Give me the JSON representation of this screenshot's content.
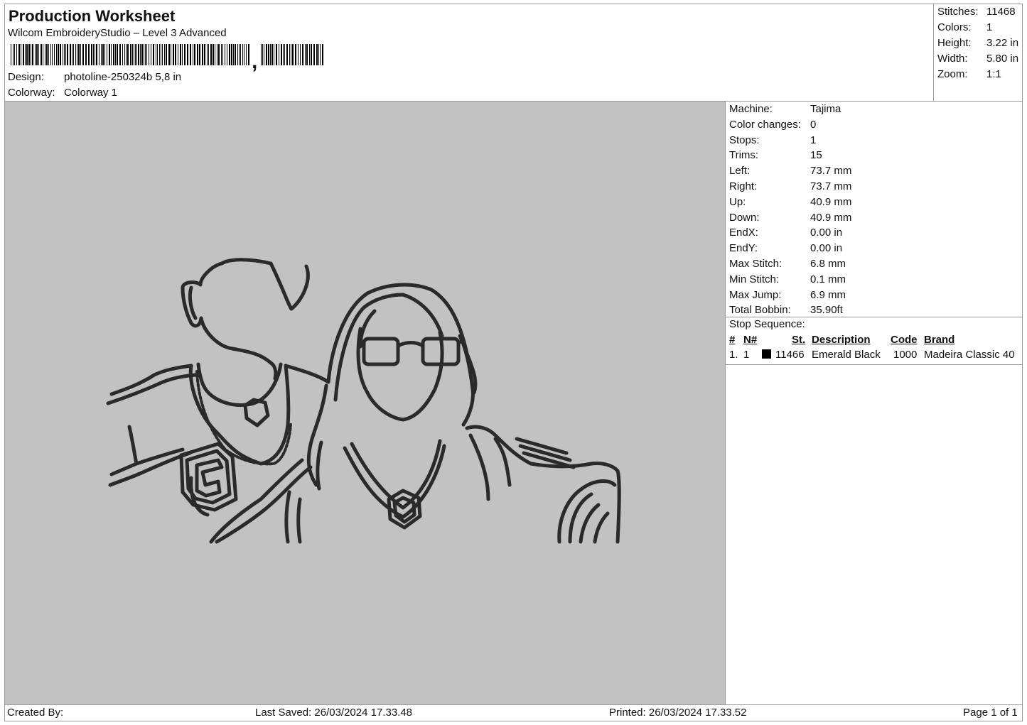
{
  "header": {
    "title": "Production Worksheet",
    "app": "Wilcom EmbroideryStudio – Level 3 Advanced",
    "barcode_icon": "barcode-icon",
    "design_label": "Design:",
    "design_value": "photoline-250324b 5,8 in",
    "colorway_label": "Colorway:",
    "colorway_value": "Colorway 1"
  },
  "summary": [
    {
      "label": "Stitches:",
      "value": "11468"
    },
    {
      "label": "Colors:",
      "value": "1"
    },
    {
      "label": "Height:",
      "value": "3.22 in"
    },
    {
      "label": "Width:",
      "value": "5.80 in"
    },
    {
      "label": "Zoom:",
      "value": "1:1"
    }
  ],
  "machine_info": [
    {
      "label": "Machine:",
      "value": "Tajima"
    },
    {
      "label": "Color changes:",
      "value": "0"
    },
    {
      "label": "Stops:",
      "value": "1"
    },
    {
      "label": "Trims:",
      "value": "15"
    },
    {
      "label": "Left:",
      "value": "73.7 mm"
    },
    {
      "label": "Right:",
      "value": "73.7 mm"
    },
    {
      "label": "Up:",
      "value": "40.9 mm"
    },
    {
      "label": "Down:",
      "value": "40.9 mm"
    },
    {
      "label": "EndX:",
      "value": "0.00 in"
    },
    {
      "label": "EndY:",
      "value": "0.00 in"
    },
    {
      "label": "Max Stitch:",
      "value": "6.8 mm"
    },
    {
      "label": "Min Stitch:",
      "value": "0.1 mm"
    },
    {
      "label": "Max Jump:",
      "value": "6.9 mm"
    },
    {
      "label": "Total Bobbin:",
      "value": "35.90ft"
    }
  ],
  "stop_sequence": {
    "title": "Stop Sequence:",
    "headers": {
      "num": "#",
      "n": "N#",
      "st": "St.",
      "description": "Description",
      "code": "Code",
      "brand": "Brand"
    },
    "rows": [
      {
        "num": "1.",
        "n": "1",
        "color": "#000000",
        "st": "11466",
        "description": "Emerald Black",
        "code": "1000",
        "brand": "Madeira Classic 40"
      }
    ]
  },
  "design_preview": {
    "background": "#c2c2c2",
    "thread_color": "#2a2a2a"
  },
  "footer": {
    "created_by": "Created By:",
    "last_saved": "Last Saved: 26/03/2024 17.33.48",
    "printed": "Printed: 26/03/2024 17.33.52",
    "page": "Page 1 of 1"
  }
}
